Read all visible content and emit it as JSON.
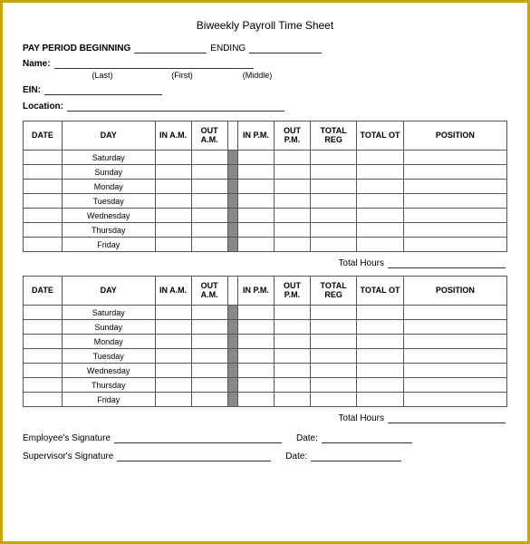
{
  "title": "Biweekly Payroll Time Sheet",
  "fields": {
    "pay_period_beginning_label": "PAY PERIOD BEGINNING",
    "ending_label": "ENDING",
    "name_label": "Name:",
    "last_label": "(Last)",
    "first_label": "(First)",
    "middle_label": "(Middle)",
    "ein_label": "EIN:",
    "location_label": "Location:"
  },
  "table_headers": {
    "date": "DATE",
    "day": "DAY",
    "in_am": "IN A.M.",
    "out_am": "OUT A.M.",
    "in_pm": "IN P.M.",
    "out_pm": "OUT P.M.",
    "total_reg": "TOTAL REG",
    "total_ot": "TOTAL OT",
    "position": "POSITION"
  },
  "days": [
    "Saturday",
    "Sunday",
    "Monday",
    "Tuesday",
    "Wednesday",
    "Thursday",
    "Friday"
  ],
  "total_hours_label": "Total Hours",
  "signatures": {
    "employee_label": "Employee's Signature",
    "supervisor_label": "Supervisor's Signature",
    "date_label": "Date:"
  }
}
